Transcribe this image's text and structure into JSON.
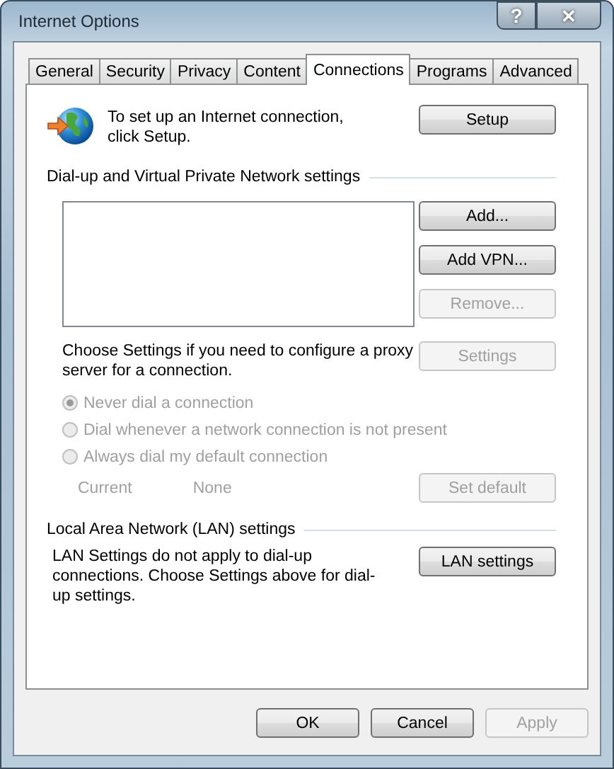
{
  "window": {
    "title": "Internet Options",
    "title_buttons": [
      {
        "kind": "help",
        "label": "?"
      },
      {
        "kind": "close",
        "label": "✕"
      }
    ]
  },
  "tabs": [
    {
      "label": "General",
      "selected": false
    },
    {
      "label": "Security",
      "selected": false
    },
    {
      "label": "Privacy",
      "selected": false
    },
    {
      "label": "Content",
      "selected": false
    },
    {
      "label": "Connections",
      "selected": true
    },
    {
      "label": "Programs",
      "selected": false
    },
    {
      "label": "Advanced",
      "selected": false
    }
  ],
  "setup": {
    "text": "To set up an Internet connection, click Setup.",
    "button": {
      "label": "Setup",
      "disabled": false
    }
  },
  "dialup": {
    "heading": "Dial-up and Virtual Private Network settings",
    "buttons": [
      {
        "label": "Add...",
        "disabled": false
      },
      {
        "label": "Add VPN...",
        "disabled": false
      },
      {
        "label": "Remove...",
        "disabled": true
      }
    ],
    "proxy_text": "Choose Settings if you need to configure a proxy server for a connection.",
    "settings_button": {
      "label": "Settings",
      "disabled": true
    },
    "options": [
      {
        "label": "Never dial a connection",
        "selected": true,
        "disabled": true
      },
      {
        "label": "Dial whenever a network connection is not present",
        "selected": false,
        "disabled": true
      },
      {
        "label": "Always dial my default connection",
        "selected": false,
        "disabled": true
      }
    ],
    "current_label": "Current",
    "current_value": "None",
    "current_disabled": true,
    "default_button": {
      "label": "Set default",
      "disabled": true
    }
  },
  "lan": {
    "heading": "Local Area Network (LAN) settings",
    "text": "LAN Settings do not apply to dial-up connections. Choose Settings above for dial-up settings.",
    "button": {
      "label": "LAN settings",
      "disabled": false
    }
  },
  "footer": [
    {
      "label": "OK",
      "disabled": false
    },
    {
      "label": "Cancel",
      "disabled": false
    },
    {
      "label": "Apply",
      "disabled": true
    }
  ]
}
